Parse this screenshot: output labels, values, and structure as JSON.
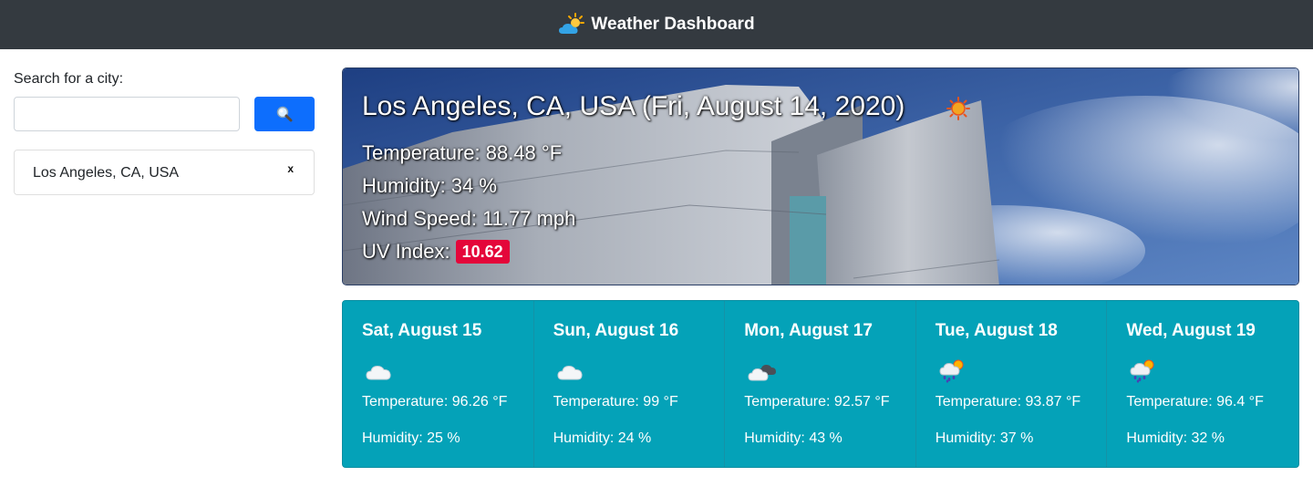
{
  "app": {
    "title": "Weather Dashboard",
    "brand_icon": "sun-behind-cloud-icon"
  },
  "search": {
    "label": "Search for a city:",
    "value": "",
    "placeholder": "",
    "button_icon": "magnifying-glass-icon"
  },
  "history": [
    {
      "label": "Los Angeles, CA, USA",
      "remove_label": "x"
    }
  ],
  "current": {
    "title": "Los Angeles, CA, USA (Fri, August 14, 2020)",
    "icon": "sun-icon",
    "temperature": "Temperature: 88.48 °F",
    "humidity": "Humidity: 34 %",
    "wind": "Wind Speed: 11.77 mph",
    "uv_label": "UV Index:",
    "uv_value": "10.62",
    "uv_color": "#e4063a"
  },
  "forecast": [
    {
      "date": "Sat, August 15",
      "icon": "cloud-icon",
      "temperature": "Temperature: 96.26 °F",
      "humidity": "Humidity: 25 %"
    },
    {
      "date": "Sun, August 16",
      "icon": "cloud-icon",
      "temperature": "Temperature: 99 °F",
      "humidity": "Humidity: 24 %"
    },
    {
      "date": "Mon, August 17",
      "icon": "broken-clouds-icon",
      "temperature": "Temperature: 92.57 °F",
      "humidity": "Humidity: 43 %"
    },
    {
      "date": "Tue, August 18",
      "icon": "sun-rain-icon",
      "temperature": "Temperature: 93.87 °F",
      "humidity": "Humidity: 37 %"
    },
    {
      "date": "Wed, August 19",
      "icon": "sun-rain-icon",
      "temperature": "Temperature: 96.4 °F",
      "humidity": "Humidity: 32 %"
    }
  ],
  "colors": {
    "navbar": "#343a40",
    "primary_button": "#0d6efd",
    "forecast_bg": "#04a2b8"
  }
}
